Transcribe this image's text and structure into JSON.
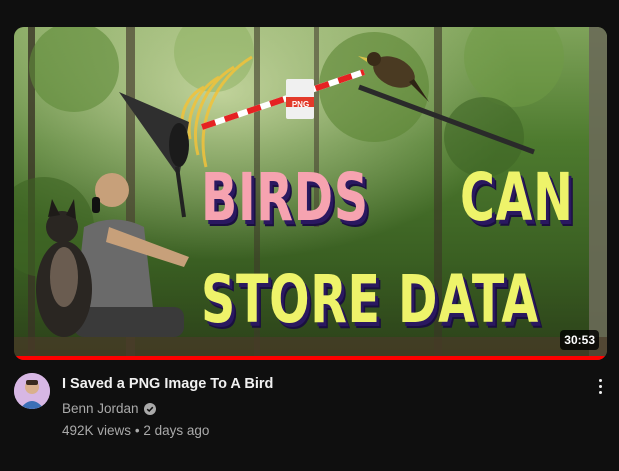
{
  "video": {
    "title": "I Saved a PNG Image To A Bird",
    "channel": "Benn Jordan",
    "views": "492K views",
    "separator": "•",
    "age": "2 days ago",
    "duration": "30:53",
    "watched_progress": 1.0,
    "channel_verified": true
  },
  "thumbnail": {
    "headline_word_1": "BIRDS",
    "headline_word_2": "CAN",
    "headline_line_2": "STORE DATA",
    "png_badge": "PNG"
  },
  "colors": {
    "background": "#0f0f0f",
    "progress": "#ff0000",
    "headline_pink": "#f6a3b0",
    "headline_yellow": "#eef36a"
  },
  "icons": {
    "menu": "more-vert-icon",
    "verified": "check-circle-icon"
  }
}
